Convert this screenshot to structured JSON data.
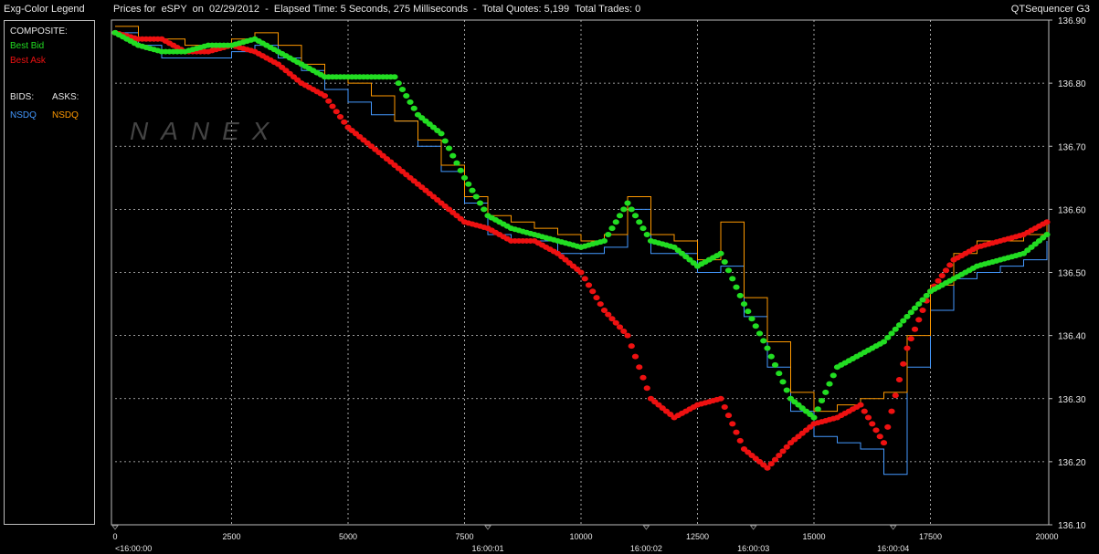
{
  "legend": {
    "title": "Exg-Color Legend",
    "composite_label": "COMPOSITE:",
    "best_bid": "Best Bid",
    "best_ask": "Best Ask",
    "bids_label": "BIDS:",
    "asks_label": "ASKS:",
    "bid_exchange": "NSDQ",
    "ask_exchange": "NSDQ"
  },
  "header": {
    "text": "Prices for  eSPY  on  02/29/2012  -  Elapsed Time: 5 Seconds, 275 Milliseconds  -  Total Quotes: 5,199  Total Trades: 0",
    "app": "QTSequencer G3"
  },
  "watermark": "NANEX",
  "colors": {
    "best_bid": "#22dd22",
    "best_ask": "#ee1111",
    "nsdq_bid": "#4499ff",
    "nsdq_ask": "#ff9900",
    "grid": "#cccccc"
  },
  "chart_data": {
    "type": "scatter",
    "title": "",
    "xlabel": "",
    "ylabel": "",
    "xlim": [
      0,
      20000
    ],
    "ylim": [
      136.1,
      136.9
    ],
    "grid": true,
    "y_ticks": [
      "136.90",
      "136.80",
      "136.70",
      "136.60",
      "136.50",
      "136.40",
      "136.30",
      "136.20",
      "136.10"
    ],
    "x_ticks": [
      "0",
      "2500",
      "5000",
      "7500",
      "10000",
      "12500",
      "15000",
      "17500",
      "20000"
    ],
    "time_labels": [
      {
        "x": 0,
        "label": "<16:00:00"
      },
      {
        "x": 8000,
        "label": "16:00:01"
      },
      {
        "x": 11400,
        "label": "16:00:02"
      },
      {
        "x": 13700,
        "label": "16:00:03"
      },
      {
        "x": 16700,
        "label": "16:00:04"
      }
    ],
    "series": [
      {
        "name": "Best Bid",
        "x": [
          0,
          500,
          1000,
          1500,
          2000,
          2500,
          3000,
          3500,
          4000,
          4500,
          5000,
          5500,
          6000,
          6500,
          7000,
          7500,
          8000,
          8500,
          9000,
          9500,
          10000,
          10500,
          11000,
          11500,
          12000,
          12500,
          13000,
          13500,
          14000,
          14500,
          15000,
          15500,
          16000,
          16500,
          17000,
          17500,
          18000,
          18500,
          19000,
          19500,
          20000
        ],
        "values": [
          136.88,
          136.86,
          136.85,
          136.85,
          136.86,
          136.86,
          136.87,
          136.85,
          136.83,
          136.81,
          136.81,
          136.81,
          136.81,
          136.75,
          136.72,
          136.65,
          136.59,
          136.57,
          136.56,
          136.55,
          136.54,
          136.55,
          136.61,
          136.55,
          136.54,
          136.51,
          136.53,
          136.45,
          136.38,
          136.3,
          136.27,
          136.35,
          136.37,
          136.39,
          136.43,
          136.47,
          136.49,
          136.51,
          136.52,
          136.53,
          136.56
        ]
      },
      {
        "name": "Best Ask",
        "x": [
          0,
          500,
          1000,
          1500,
          2000,
          2500,
          3000,
          3500,
          4000,
          4500,
          5000,
          5500,
          6000,
          6500,
          7000,
          7500,
          8000,
          8500,
          9000,
          9500,
          10000,
          10500,
          11000,
          11500,
          12000,
          12500,
          13000,
          13500,
          14000,
          14500,
          15000,
          15500,
          16000,
          16500,
          17000,
          17500,
          18000,
          18500,
          19000,
          19500,
          20000
        ],
        "values": [
          136.88,
          136.87,
          136.87,
          136.85,
          136.85,
          136.86,
          136.85,
          136.83,
          136.8,
          136.78,
          136.73,
          136.7,
          136.67,
          136.64,
          136.61,
          136.58,
          136.57,
          136.55,
          136.55,
          136.53,
          136.5,
          136.44,
          136.4,
          136.3,
          136.27,
          136.29,
          136.3,
          136.22,
          136.19,
          136.23,
          136.26,
          136.27,
          136.29,
          136.23,
          136.38,
          136.47,
          136.52,
          136.54,
          136.55,
          136.56,
          136.58
        ]
      },
      {
        "name": "NSDQ",
        "x": [
          0,
          500,
          1000,
          1500,
          2000,
          2500,
          3000,
          3500,
          4000,
          4500,
          5000,
          5500,
          6000,
          6500,
          7000,
          7500,
          8000,
          8500,
          9000,
          9500,
          10000,
          10500,
          11000,
          11500,
          12000,
          12500,
          13000,
          13500,
          14000,
          14500,
          15000,
          15500,
          16000,
          16500,
          17000,
          17500,
          18000,
          18500,
          19000,
          19500,
          20000
        ],
        "values": [
          136.88,
          136.86,
          136.84,
          136.84,
          136.84,
          136.85,
          136.86,
          136.84,
          136.82,
          136.79,
          136.77,
          136.75,
          136.74,
          136.7,
          136.66,
          136.61,
          136.56,
          136.55,
          136.55,
          136.53,
          136.53,
          136.54,
          136.6,
          136.53,
          136.53,
          136.5,
          136.51,
          136.43,
          136.35,
          136.28,
          136.24,
          136.23,
          136.22,
          136.18,
          136.35,
          136.44,
          136.49,
          136.5,
          136.51,
          136.52,
          136.55
        ]
      },
      {
        "name": "NSDQ",
        "x": [
          0,
          500,
          1000,
          1500,
          2000,
          2500,
          3000,
          3500,
          4000,
          4500,
          5000,
          5500,
          6000,
          6500,
          7000,
          7500,
          8000,
          8500,
          9000,
          9500,
          10000,
          10500,
          11000,
          11500,
          12000,
          12500,
          13000,
          13500,
          14000,
          14500,
          15000,
          15500,
          16000,
          16500,
          17000,
          17500,
          18000,
          18500,
          19000,
          19500,
          20000
        ],
        "values": [
          136.89,
          136.87,
          136.87,
          136.86,
          136.86,
          136.87,
          136.88,
          136.86,
          136.83,
          136.81,
          136.8,
          136.78,
          136.74,
          136.71,
          136.67,
          136.62,
          136.59,
          136.58,
          136.57,
          136.56,
          136.55,
          136.56,
          136.62,
          136.56,
          136.55,
          136.52,
          136.58,
          136.46,
          136.39,
          136.31,
          136.28,
          136.29,
          136.3,
          136.31,
          136.4,
          136.48,
          136.53,
          136.55,
          136.55,
          136.56,
          136.58
        ]
      }
    ]
  }
}
